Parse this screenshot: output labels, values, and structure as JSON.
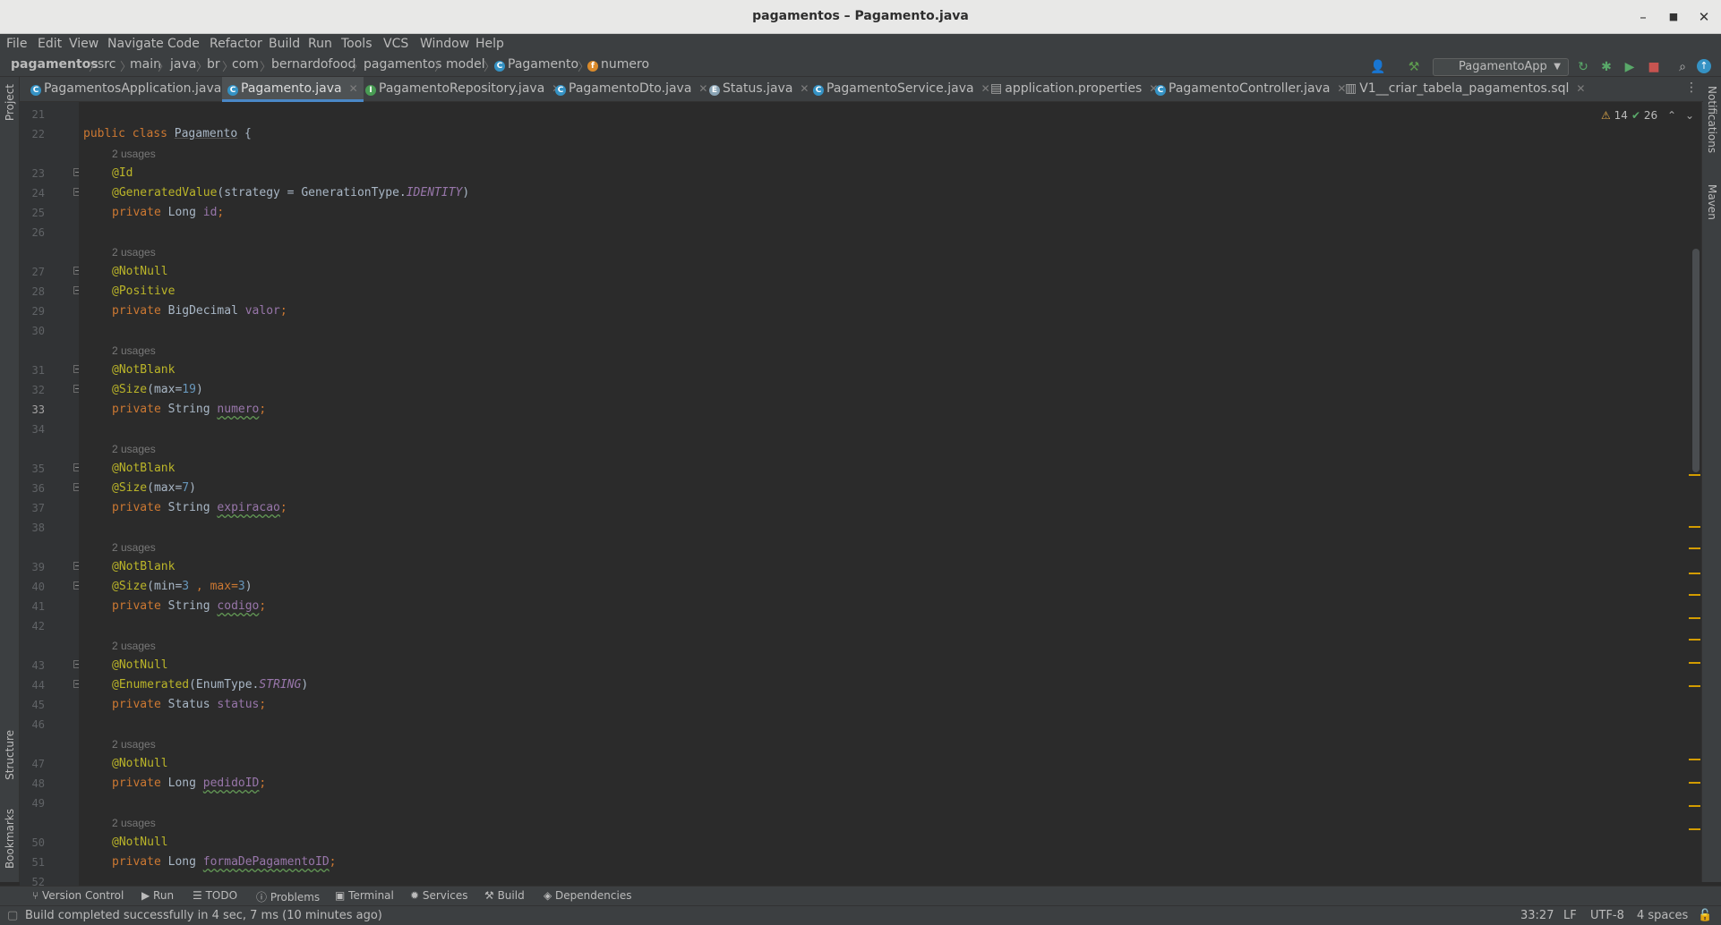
{
  "window": {
    "title": "pagamentos – Pagamento.java"
  },
  "menu": [
    "File",
    "Edit",
    "View",
    "Navigate",
    "Code",
    "Refactor",
    "Build",
    "Run",
    "Tools",
    "VCS",
    "Window",
    "Help"
  ],
  "breadcrumb": [
    "pagamentos",
    "src",
    "main",
    "java",
    "br",
    "com",
    "bernardofood",
    "pagamentos",
    "model",
    "Pagamento",
    "numero"
  ],
  "run_config": "PagamentoApp",
  "tabs": [
    "PagamentosApplication.java",
    "Pagamento.java",
    "PagamentoRepository.java",
    "PagamentoDto.java",
    "Status.java",
    "PagamentoService.java",
    "application.properties",
    "PagamentoController.java",
    "V1__criar_tabela_pagamentos.sql"
  ],
  "inspections": {
    "warnings": "14",
    "ok": "26"
  },
  "side_panels": {
    "left_top": "Project",
    "left_mid": "Structure",
    "left_bottom": "Bookmarks",
    "right_top": "Notifications",
    "right_mid": "Maven"
  },
  "code": {
    "usages": "2 usages",
    "line_numbers": [
      "21",
      "22",
      "23",
      "24",
      "25",
      "26",
      "27",
      "28",
      "29",
      "30",
      "31",
      "32",
      "33",
      "34",
      "35",
      "36",
      "37",
      "38",
      "39",
      "40",
      "41",
      "42",
      "43",
      "44",
      "45",
      "46",
      "47",
      "48",
      "49",
      "50",
      "51",
      "52"
    ],
    "class_decl": {
      "kw1": "public",
      "kw2": "class",
      "name": "Pagamento",
      "brace": " {"
    },
    "id_ann": "@Id",
    "gen_ann": "@GeneratedValue",
    "gen_args": "(strategy = GenerationType.",
    "gen_const": "IDENTITY",
    "close_paren": ")",
    "private": "private",
    "long": "Long",
    "bigdecimal": "BigDecimal",
    "string": "String",
    "status_type": "Status",
    "f_id": "id",
    "f_valor": "valor",
    "f_numero": "numero",
    "f_expiracao": "expiracao",
    "f_codigo": "codigo",
    "f_status": "status",
    "f_pedido": "pedidoID",
    "f_forma": "formaDePagamentoID",
    "semi": ";",
    "notnull": "@NotNull",
    "positive": "@Positive",
    "notblank": "@NotBlank",
    "size": "@Size",
    "size_max19": [
      "(max=",
      "19",
      ")"
    ],
    "size_max7": [
      "(max=",
      "7",
      ")"
    ],
    "size_min3": [
      "(min=",
      "3",
      " , max=",
      "3",
      ")"
    ],
    "enumerated": "@Enumerated",
    "enum_args": "(EnumType.",
    "enum_const": "STRING"
  },
  "tool_windows": [
    "Version Control",
    "Run",
    "TODO",
    "Problems",
    "Terminal",
    "Services",
    "Build",
    "Dependencies"
  ],
  "status": {
    "message": "Build completed successfully in 4 sec, 7 ms (10 minutes ago)",
    "position": "33:27",
    "line_sep": "LF",
    "encoding": "UTF-8",
    "indent": "4 spaces"
  }
}
